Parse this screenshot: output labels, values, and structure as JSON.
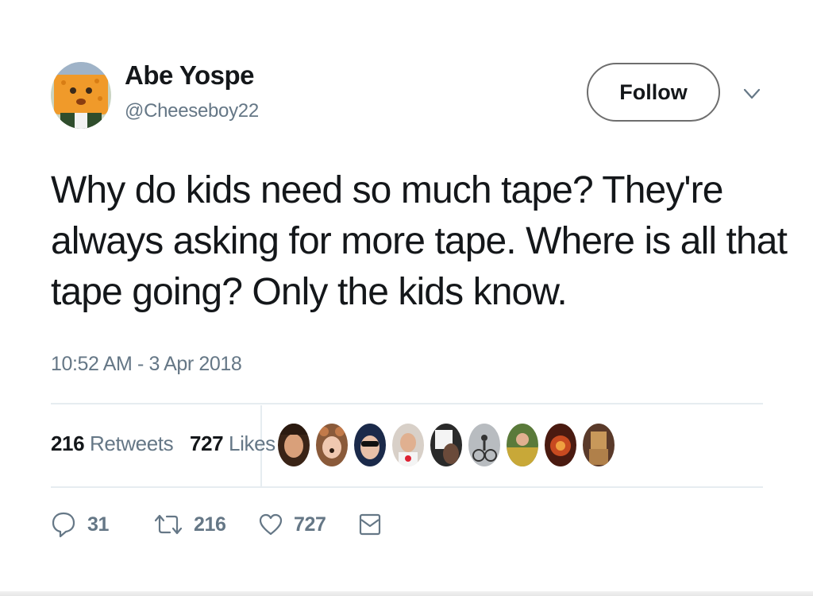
{
  "user": {
    "display_name": "Abe Yospe",
    "username": "@Cheeseboy22"
  },
  "follow_label": "Follow",
  "tweet": {
    "lines": [
      "Why do kids need so much tape? They're",
      "always asking for more tape. Where is all that",
      "tape going? Only the kids know."
    ],
    "timestamp": "10:52 AM - 3 Apr 2018"
  },
  "stats": {
    "retweets_count": "216",
    "retweets_label": "Retweets",
    "likes_count": "727",
    "likes_label": "Likes"
  },
  "actions": {
    "reply_count": "31",
    "retweet_count": "216",
    "like_count": "727"
  },
  "icons": {
    "reply": "reply-icon",
    "retweet": "retweet-icon",
    "like": "heart-icon",
    "dm": "envelope-icon",
    "caret": "chevron-down-icon"
  },
  "colors": {
    "text": "#14171a",
    "muted": "#657786",
    "border": "#e6ecf0"
  }
}
